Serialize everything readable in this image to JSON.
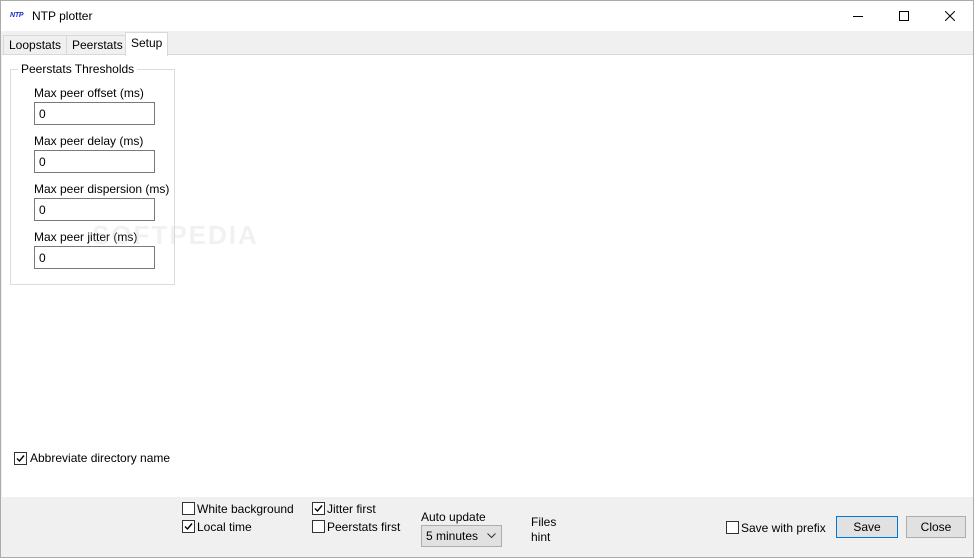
{
  "window": {
    "icon_text": "NTP",
    "title": "NTP plotter"
  },
  "tabs": [
    {
      "label": "Loopstats"
    },
    {
      "label": "Peerstats"
    },
    {
      "label": "Setup"
    }
  ],
  "active_tab": "Setup",
  "thresholds": {
    "group_title": "Peerstats Thresholds",
    "fields": [
      {
        "label": "Max peer offset (ms)",
        "value": "0"
      },
      {
        "label": "Max peer delay (ms)",
        "value": "0"
      },
      {
        "label": "Max peer dispersion (ms)",
        "value": "0"
      },
      {
        "label": "Max peer jitter (ms)",
        "value": "0"
      }
    ]
  },
  "watermark": "SOFTPEDIA",
  "abbreviate": {
    "label": "Abbreviate directory name",
    "checked": true
  },
  "options": {
    "white_background": {
      "label": "White background",
      "checked": false
    },
    "local_time": {
      "label": "Local time",
      "checked": true
    },
    "jitter_first": {
      "label": "Jitter first",
      "checked": true
    },
    "peerstats_first": {
      "label": "Peerstats first",
      "checked": false
    }
  },
  "auto_update": {
    "label": "Auto update",
    "selected": "5 minutes"
  },
  "files_hint": {
    "line1": "Files",
    "line2": "hint"
  },
  "save_with_prefix": {
    "label": "Save with prefix",
    "checked": false
  },
  "buttons": {
    "save": "Save",
    "close": "Close"
  }
}
